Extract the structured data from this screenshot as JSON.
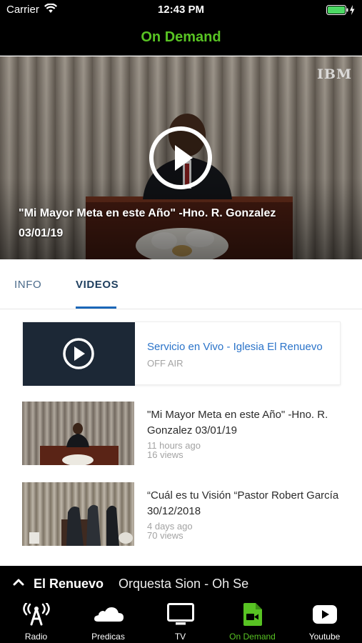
{
  "status_bar": {
    "carrier": "Carrier",
    "time": "12:43 PM",
    "battery_color": "#4cd964",
    "icons": [
      "wifi-icon",
      "battery-icon",
      "charging-icon"
    ]
  },
  "nav": {
    "title": "On Demand",
    "title_color": "#58c323"
  },
  "hero": {
    "watermark": "IBM",
    "title": "\"Mi Mayor Meta en este Año\" -Hno. R. Gonzalez",
    "date": "03/01/19",
    "icon": "play-circle-icon"
  },
  "tabs": [
    {
      "label": "INFO",
      "active": false
    },
    {
      "label": "VIDEOS",
      "active": true
    }
  ],
  "tab_accent": "#1a67b8",
  "videos": [
    {
      "title": "Servicio en Vivo - Iglesia El Renuevo",
      "status": "OFF AIR",
      "live": true
    },
    {
      "title": "\"Mi Mayor Meta en este Año\" -Hno. R. Gonzalez 03/01/19",
      "age": "11 hours ago",
      "views": "16 views"
    },
    {
      "title": "“Cuál es tu Visión “Pastor Robert García 30/12/2018",
      "age": "4 days ago",
      "views": "70 views"
    }
  ],
  "now_playing": {
    "station": "El Renuevo",
    "track": "Orquesta Sion - Oh Se",
    "icon": "chevron-up-icon"
  },
  "tab_bar": [
    {
      "label": "Radio",
      "icon": "radio-antenna-icon",
      "active": false
    },
    {
      "label": "Predicas",
      "icon": "cloud-icon",
      "active": false
    },
    {
      "label": "TV",
      "icon": "tv-icon",
      "active": false
    },
    {
      "label": "On Demand",
      "icon": "video-file-icon",
      "active": true
    },
    {
      "label": "Youtube",
      "icon": "youtube-icon",
      "active": false
    }
  ],
  "active_color": "#58c323"
}
